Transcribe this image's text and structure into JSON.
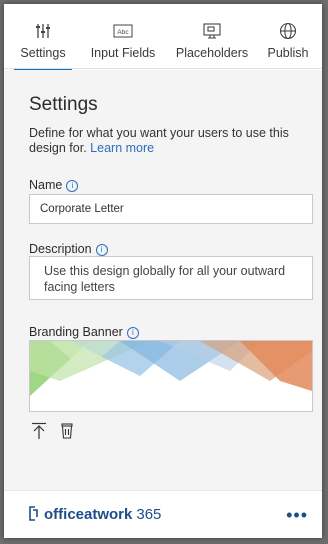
{
  "tabs": [
    {
      "label": "Settings",
      "icon": "sliders-icon",
      "active": true
    },
    {
      "label": "Input Fields",
      "icon": "abc-field-icon",
      "active": false
    },
    {
      "label": "Placeholders",
      "icon": "placeholder-icon",
      "active": false
    },
    {
      "label": "Publish",
      "icon": "globe-icon",
      "active": false
    }
  ],
  "icon_abc_text": "Abc",
  "settings": {
    "title": "Settings",
    "description": "Define for what you want your users to use this design for.",
    "learn_more": "Learn more",
    "name_label": "Name",
    "name_value": "Corporate Letter",
    "description_label": "Description",
    "description_value": "Use this design globally for all your outward facing letters",
    "banner_label": "Branding Banner",
    "info_glyph": "i"
  },
  "footer": {
    "brand_name": "officeatwork",
    "brand_suffix": "365",
    "more_label": "•••"
  },
  "colors": {
    "accent": "#0a6ec4",
    "link": "#2a6fbf",
    "brand": "#1d4e8a",
    "banner_green": "#8fcf6e",
    "banner_blue": "#8fb9e0",
    "banner_orange": "#e3895a"
  }
}
